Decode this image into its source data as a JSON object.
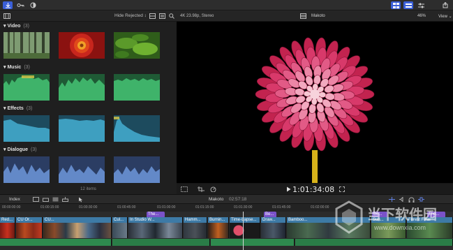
{
  "browser": {
    "filter_label": "Hide Rejected ↕",
    "footer": "12 items",
    "sections": [
      {
        "title": "Video",
        "count": "(3)"
      },
      {
        "title": "Music",
        "count": "(3)"
      },
      {
        "title": "Effects",
        "count": "(3)"
      },
      {
        "title": "Dialogue",
        "count": "(3)"
      }
    ]
  },
  "viewer": {
    "format": "4K 23.98p, Stereo",
    "project": "Makoto",
    "zoom": "46%",
    "view_menu": "View ⌄",
    "timecode": "1:01:34:08"
  },
  "timeline": {
    "index_label": "Index",
    "project": "Makoto",
    "duration": "02:57:18",
    "ruler_labels": [
      "00:00:00:00",
      "01:00:15:00",
      "01:00:30:00",
      "01:00:45:00",
      "01:01:00:00",
      "01:01:15:00",
      "01:01:30:00",
      "01:01:45:00",
      "01:02:00:00"
    ],
    "connected_clips": [
      {
        "label": "The..."
      },
      {
        "label": "Be..."
      },
      {
        "label": "Be..."
      },
      {
        "label": "The..."
      }
    ],
    "primary_clips": [
      {
        "label": "Red..."
      },
      {
        "label": "CU Or..."
      },
      {
        "label": "CU..."
      },
      {
        "label": "Cul..."
      },
      {
        "label": "In Studio W..."
      },
      {
        "label": "Hamm..."
      },
      {
        "label": "Burnin..."
      },
      {
        "label": "Time-Lapse..."
      },
      {
        "label": "Draw..."
      },
      {
        "label": "Bamboo..."
      },
      {
        "label": "Sun..."
      },
      {
        "label": "Forest Final"
      }
    ]
  },
  "watermark": {
    "title": "当下软件园",
    "url": "www.downxia.com"
  },
  "colors": {
    "accent": "#3a5fd8",
    "clip_blue": "#3d7aa6",
    "audio_green": "#2e8a4e",
    "title_purple": "#7a52c9",
    "playhead": "#d7d7d7"
  }
}
